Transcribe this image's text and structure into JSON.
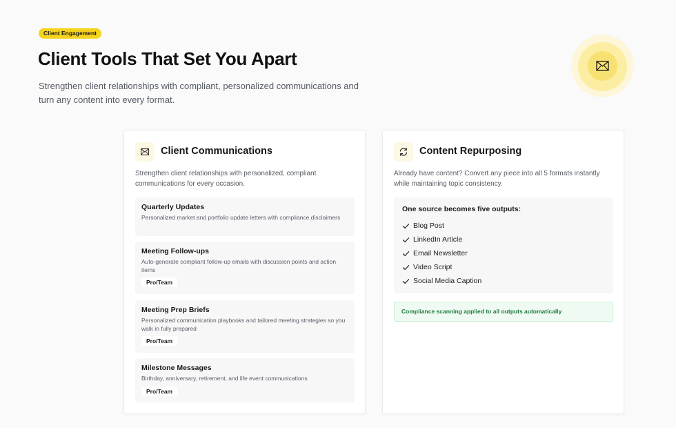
{
  "header": {
    "badge": "Client Engagement",
    "title": "Client Tools That Set You Apart",
    "subtitle": "Strengthen client relationships with compliant, personalized communications and turn any content into every format."
  },
  "hero_icon": "envelope-icon",
  "colors": {
    "accent": "#f6d31d",
    "success_text": "#1f7a3e",
    "success_bg": "#effaf2"
  },
  "communications": {
    "icon": "envelope-icon",
    "title": "Client Communications",
    "description": "Strengthen client relationships with personalized, compliant communications for every occasion.",
    "features": [
      {
        "title": "Quarterly Updates",
        "description": "Personalized market and portfolio update letters with compliance disclaimers",
        "tag": ""
      },
      {
        "title": "Meeting Follow-ups",
        "description": "Auto-generate compliant follow-up emails with discussion points and action items",
        "tag": "Pro/Team"
      },
      {
        "title": "Meeting Prep Briefs",
        "description": "Personalized communication playbooks and tailored meeting strategies so you walk in fully prepared",
        "tag": "Pro/Team"
      },
      {
        "title": "Milestone Messages",
        "description": "Birthday, anniversary, retirement, and life event communications",
        "tag": "Pro/Team"
      }
    ]
  },
  "repurposing": {
    "icon": "refresh-icon",
    "title": "Content Repurposing",
    "description": "Already have content? Convert any piece into all 5 formats instantly while maintaining topic consistency.",
    "outputs_title": "One source becomes five outputs:",
    "outputs": [
      "Blog Post",
      "LinkedIn Article",
      "Email Newsletter",
      "Video Script",
      "Social Media Caption"
    ],
    "compliance_note": "Compliance scanning applied to all outputs automatically"
  }
}
